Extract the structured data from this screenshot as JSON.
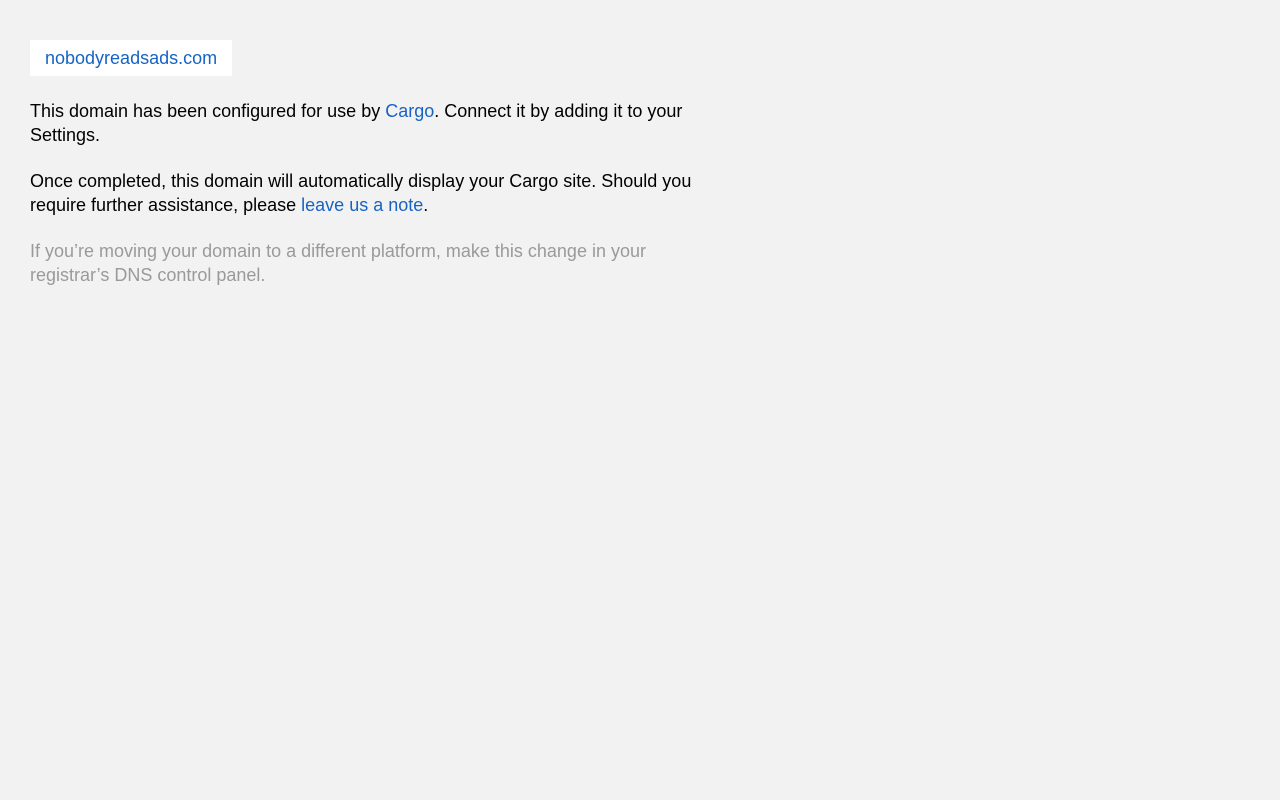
{
  "domain": {
    "name": "nobodyreadsads.com"
  },
  "paragraph1": {
    "before": "This domain has been configured for use by ",
    "link": "Cargo",
    "after": ". Connect it by adding it to your Settings."
  },
  "paragraph2": {
    "before": "Once completed, this domain will automatically display your Cargo site. Should you require further assistance, please ",
    "link": "leave us a note",
    "after": "."
  },
  "paragraph3": {
    "text": "If you’re moving your domain to a different platform, make this change in your registrar’s DNS control panel."
  },
  "colors": {
    "background": "#f2f2f2",
    "link": "#1763c4",
    "muted": "#9a9a9a"
  }
}
